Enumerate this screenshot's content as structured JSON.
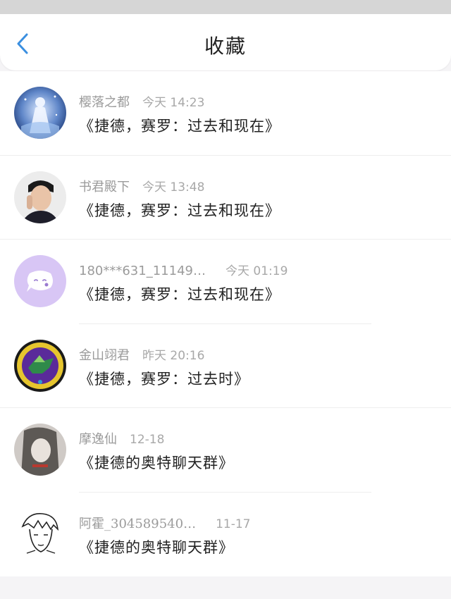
{
  "header": {
    "title": "收藏"
  },
  "items": [
    {
      "name": "樱落之都",
      "time": "今天 14:23",
      "message": "《捷德，赛罗：过去和现在》"
    },
    {
      "name": "书君殿下",
      "time": "今天 13:48",
      "message": "《捷德，赛罗：过去和现在》"
    },
    {
      "name": "180***631_11149…",
      "time": "今天 01:19",
      "message": "《捷德，赛罗：过去和现在》"
    },
    {
      "name": "金山翊君",
      "time": "昨天 20:16",
      "message": "《捷德，赛罗：过去时》"
    },
    {
      "name": "摩逸仙",
      "time": "12-18",
      "message": "《捷德的奥特聊天群》"
    },
    {
      "name": "阿霍_304589540…",
      "time": "11-17",
      "message": "《捷德的奥特聊天群》"
    }
  ],
  "colors": {
    "accent": "#3b8fe0",
    "avatar_lavender": "#d8c6f5"
  }
}
